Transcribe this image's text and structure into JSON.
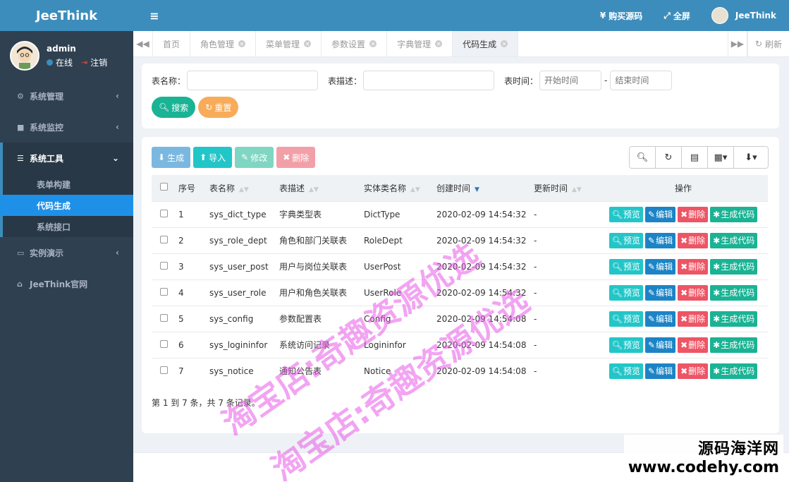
{
  "app": {
    "brand": "JeeThink"
  },
  "user": {
    "name": "admin",
    "status": "在线",
    "logout": "注销"
  },
  "sidebar": {
    "items": [
      {
        "label": "系统管理",
        "icon": "gear-icon",
        "arrow": "‹"
      },
      {
        "label": "系统监控",
        "icon": "video-icon",
        "arrow": "‹"
      },
      {
        "label": "系统工具",
        "icon": "bars-icon",
        "arrow": "⌄"
      },
      {
        "label": "实例演示",
        "icon": "desktop-icon",
        "arrow": "‹"
      },
      {
        "label": "JeeThink官网",
        "icon": "home-icon"
      }
    ],
    "sub_items": [
      {
        "label": "表单构建"
      },
      {
        "label": "代码生成"
      },
      {
        "label": "系统接口"
      }
    ]
  },
  "header": {
    "menu_icon": "≡",
    "buy_source": "购买源码",
    "fullscreen": "全屏",
    "user_name": "JeeThink"
  },
  "tabs": {
    "items": [
      "首页",
      "角色管理",
      "菜单管理",
      "参数设置",
      "字典管理",
      "代码生成"
    ],
    "refresh": "刷新"
  },
  "search": {
    "table_name_label": "表名称：",
    "table_desc_label": "表描述：",
    "table_time_label": "表时间：",
    "start_placeholder": "开始时间",
    "end_placeholder": "结束时间",
    "dash": "-",
    "search_button": "搜索",
    "reset_button": "重置"
  },
  "toolbar": {
    "generate": "生成",
    "import": "导入",
    "edit": "修改",
    "delete": "删除"
  },
  "table": {
    "headers": [
      "序号",
      "表名称",
      "表描述",
      "实体类名称",
      "创建时间",
      "更新时间",
      "操作"
    ],
    "rows": [
      {
        "no": "1",
        "name": "sys_dict_type",
        "desc": "字典类型表",
        "entity": "DictType",
        "created": "2020-02-09 14:54:32",
        "updated": "-"
      },
      {
        "no": "2",
        "name": "sys_role_dept",
        "desc": "角色和部门关联表",
        "entity": "RoleDept",
        "created": "2020-02-09 14:54:32",
        "updated": "-"
      },
      {
        "no": "3",
        "name": "sys_user_post",
        "desc": "用户与岗位关联表",
        "entity": "UserPost",
        "created": "2020-02-09 14:54:32",
        "updated": "-"
      },
      {
        "no": "4",
        "name": "sys_user_role",
        "desc": "用户和角色关联表",
        "entity": "UserRole",
        "created": "2020-02-09 14:54:32",
        "updated": "-"
      },
      {
        "no": "5",
        "name": "sys_config",
        "desc": "参数配置表",
        "entity": "Config",
        "created": "2020-02-09 14:54:08",
        "updated": "-"
      },
      {
        "no": "6",
        "name": "sys_logininfor",
        "desc": "系统访问记录",
        "entity": "Logininfor",
        "created": "2020-02-09 14:54:08",
        "updated": "-"
      },
      {
        "no": "7",
        "name": "sys_notice",
        "desc": "通知公告表",
        "entity": "Notice",
        "created": "2020-02-09 14:54:08",
        "updated": "-"
      }
    ],
    "row_actions": {
      "preview": "预览",
      "edit": "编辑",
      "delete": "删除",
      "gen": "生成代码"
    },
    "summary": "第 1 到 7 条，共 7 条记录。"
  },
  "watermark": {
    "line1": "淘宝店:奇趣资源优选",
    "line2": "淘宝店:奇趣资源优选",
    "site_name": "源码海洋网",
    "site_url": "www.codehy.com"
  },
  "colors": {
    "primary": "#3c8dbc",
    "sidebar": "#2f4050",
    "teal": "#1ab394",
    "info": "#23c6c8",
    "warning": "#f8ac59",
    "danger": "#ed5565",
    "blue": "#1c84c6"
  }
}
